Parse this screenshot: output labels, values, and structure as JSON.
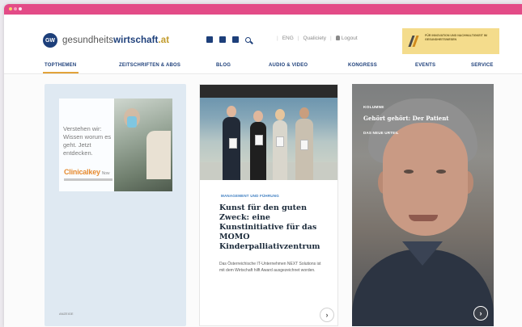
{
  "header": {
    "logo_mark": "GW",
    "logo_prefix": "gesundheits",
    "logo_bold": "wirtschaft",
    "logo_tld": ".at",
    "links": [
      "ENG",
      "Qualiciety",
      "Logout"
    ],
    "promo_text": "Für Innovation und Nachhaltigkeit im Gesundheitswesen"
  },
  "nav": {
    "items": [
      "Topthemen",
      "Zeitschriften & Abos",
      "Blog",
      "Audio & Video",
      "Kongress",
      "Events",
      "Service"
    ]
  },
  "ad": {
    "text": "Verstehen wir: Wissen worum es geht. Jetzt entdecken.",
    "brand": "Clinicalkey",
    "brand_suffix": "Now",
    "label": "Anzeige"
  },
  "article": {
    "category": "Management und Führung",
    "title": "Kunst für den guten Zweck: eine Kunstinitiative für das MOMO Kinderpalliativzentrum",
    "excerpt": "Das Österreichische IT-Unternehmen NEXT Solutions ist mit dem Wirtschaft hilft Award ausgezeichnet worden."
  },
  "column": {
    "label": "Kolumne",
    "title": "Gehört gehört: Der Patient",
    "author": "Das neue Urteil"
  },
  "colors": {
    "brand_blue": "#1d3f7a",
    "accent_gold": "#e2a33a",
    "titlebar_pink": "#e34b87"
  }
}
